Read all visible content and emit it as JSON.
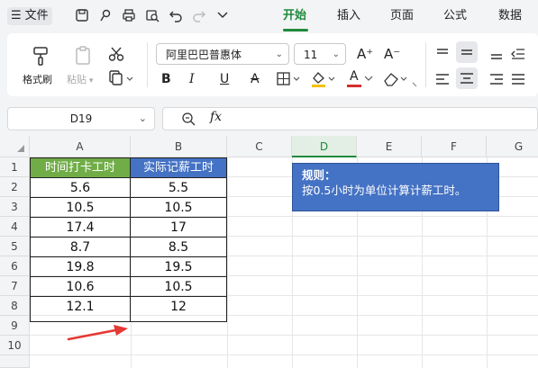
{
  "menu": {
    "hamburger": "☰",
    "file_label": "文件",
    "tabs": [
      {
        "label": "开始",
        "active": true
      },
      {
        "label": "插入",
        "active": false
      },
      {
        "label": "页面",
        "active": false
      },
      {
        "label": "公式",
        "active": false
      },
      {
        "label": "数据",
        "active": false
      }
    ]
  },
  "ribbon": {
    "format_painter_label": "格式刷",
    "paste_label": "粘贴",
    "font_name": "阿里巴巴普惠体",
    "font_size": "11",
    "bold": "B",
    "italic": "I",
    "underline": "U",
    "strike": "A",
    "font_color_letter": "A",
    "grow_font": "A⁺",
    "shrink_font": "A⁻",
    "fill_color": "#f2c100",
    "font_color": "#d32f2f"
  },
  "formula_bar": {
    "name_box": "D19",
    "fx_label": "fx",
    "formula": ""
  },
  "grid": {
    "columns": [
      "A",
      "B",
      "C",
      "D",
      "E",
      "F",
      "G"
    ],
    "selected_column": "D",
    "rows": [
      "1",
      "2",
      "3",
      "4",
      "5",
      "6",
      "7",
      "8",
      "9",
      "10"
    ],
    "header_a": "时间打卡工时",
    "header_b": "实际记薪工时",
    "header_a_color": "#70ad47",
    "header_b_color": "#4472c4",
    "col_a_values": [
      "5.6",
      "10.5",
      "17.4",
      "8.7",
      "19.8",
      "10.6",
      "12.1"
    ],
    "col_b_values": [
      "5.5",
      "10.5",
      "17",
      "8.5",
      "19.5",
      "10.5",
      "12"
    ]
  },
  "note": {
    "title": "规则：",
    "text": "按0.5小时为单位计算计薪工时。"
  },
  "accent_color": "#1f8a3b",
  "arrow_color": "#e53935"
}
